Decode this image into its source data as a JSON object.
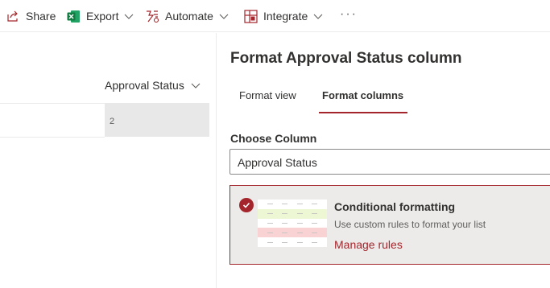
{
  "toolbar": {
    "share": {
      "label": "Share",
      "icon": "share-icon"
    },
    "export": {
      "label": "Export",
      "icon": "excel-icon"
    },
    "automate": {
      "label": "Automate",
      "icon": "flow-icon"
    },
    "integrate": {
      "label": "Integrate",
      "icon": "integrate-icon"
    },
    "more": "···"
  },
  "list": {
    "column_header": "Approval Status",
    "cell_value": "2"
  },
  "panel": {
    "title": "Format Approval Status column",
    "tabs": [
      {
        "label": "Format view",
        "selected": false
      },
      {
        "label": "Format columns",
        "selected": true
      }
    ],
    "choose_column_label": "Choose Column",
    "choose_column_value": "Approval Status",
    "option": {
      "title": "Conditional formatting",
      "description": "Use custom rules to format your list",
      "link": "Manage rules",
      "selected": true,
      "preview_rows": [
        "#ffffff",
        "#eef7d4",
        "#ffffff",
        "#f9d3d3",
        "#ffffff"
      ]
    }
  },
  "colors": {
    "accent": "#a4262c",
    "excel_green": "#107c41",
    "card_bg": "#edebe9",
    "cell_bg": "#e8e8e8"
  }
}
